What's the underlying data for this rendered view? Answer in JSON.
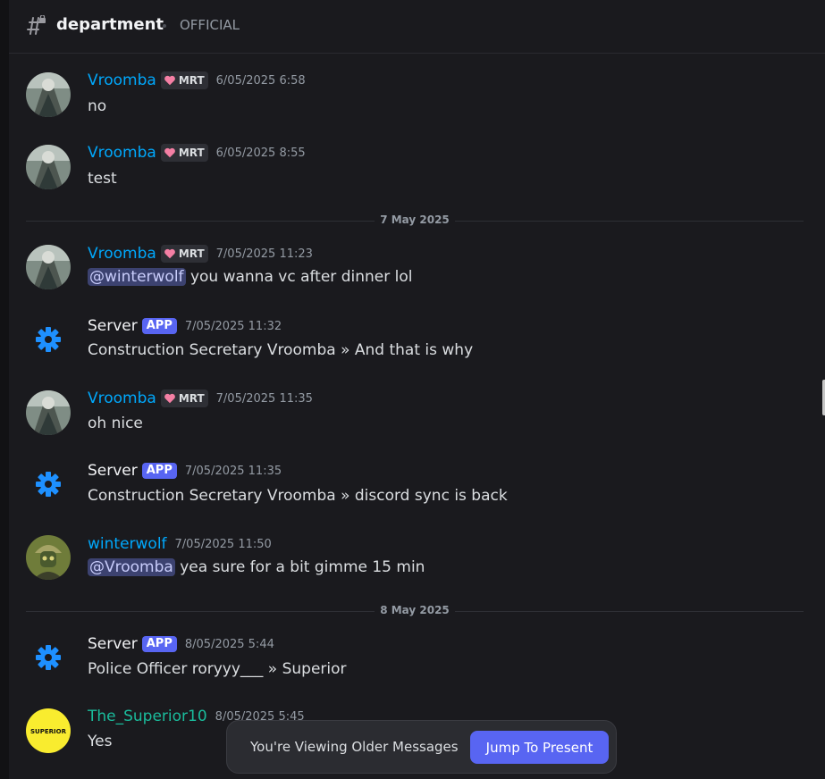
{
  "header": {
    "channel_name": "department",
    "topic": "OFFICIAL"
  },
  "colors": {
    "accent": "#5865f2",
    "username_blue": "#00a8fc",
    "username_teal": "#1abc9c",
    "background": "#1a1a1e"
  },
  "dividers": [
    "7 May 2025",
    "8 May 2025"
  ],
  "messages": [
    {
      "author": "Vroomba",
      "role": "MRT",
      "timestamp": "6/05/2025 6:58",
      "text": "no"
    },
    {
      "author": "Vroomba",
      "role": "MRT",
      "timestamp": "6/05/2025 8:55",
      "text": "test"
    },
    {
      "author": "Vroomba",
      "role": "MRT",
      "timestamp": "7/05/2025 11:23",
      "mention": "@winterwolf",
      "text": "you wanna vc after dinner lol"
    },
    {
      "author": "Server",
      "badge": "APP",
      "timestamp": "7/05/2025 11:32",
      "text": "Construction Secretary Vroomba » And that is why"
    },
    {
      "author": "Vroomba",
      "role": "MRT",
      "timestamp": "7/05/2025 11:35",
      "text": "oh nice"
    },
    {
      "author": "Server",
      "badge": "APP",
      "timestamp": "7/05/2025 11:35",
      "text": "Construction Secretary Vroomba » discord sync is back"
    },
    {
      "author": "winterwolf",
      "timestamp": "7/05/2025 11:50",
      "mention": "@Vroomba",
      "text": "yea sure for a bit gimme 15 min"
    },
    {
      "author": "Server",
      "badge": "APP",
      "timestamp": "8/05/2025 5:44",
      "text": "Police Officer roryyy___ » Superior"
    },
    {
      "author": "The_Superior10",
      "timestamp": "8/05/2025 5:45",
      "avatar_text": "SUPERIOR",
      "text": "Yes"
    }
  ],
  "older_bar": {
    "label": "You're Viewing Older Messages",
    "button": "Jump To Present"
  },
  "icons": {
    "channel": "text-channel-locked-icon",
    "server": "gear-icon",
    "role": "heart-icon"
  }
}
